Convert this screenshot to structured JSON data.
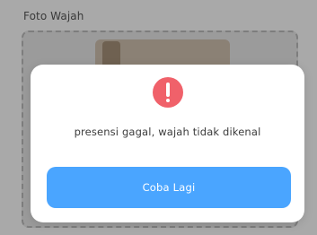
{
  "background": {
    "title": "Foto Wajah"
  },
  "dialog": {
    "icon": "error-exclamation-icon",
    "icon_color": "#f0616a",
    "message": "presensi gagal, wajah tidak dikenal",
    "button_label": "Coba Lagi",
    "button_color": "#4aa5ff"
  }
}
